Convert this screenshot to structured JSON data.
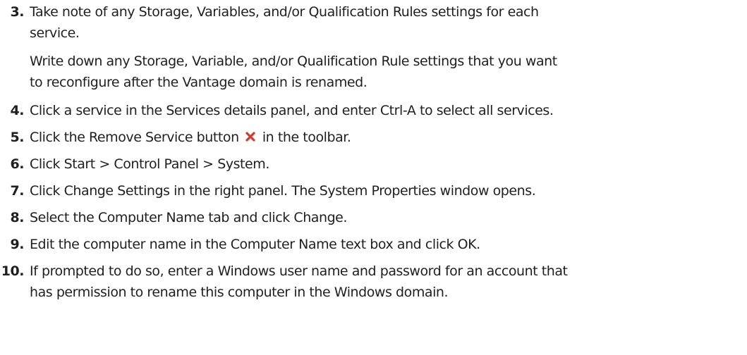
{
  "steps": [
    {
      "number": "3.",
      "lines": [
        "Take note of any Storage, Variables, and/or Qualification Rules settings for each",
        "service."
      ]
    },
    {
      "note_lines": [
        "Write down any Storage, Variable, and/or Qualification Rule settings that you want",
        "to reconfigure after the Vantage domain is renamed."
      ]
    },
    {
      "number": "4.",
      "text": "Click a service in the Services details panel, and enter Ctrl-A to select all services."
    },
    {
      "number": "5.",
      "before_icon": "Click the Remove Service button",
      "after_icon": "in the toolbar.",
      "icon": "remove-service-icon",
      "icon_color": "#d33a2c"
    },
    {
      "number": "6.",
      "text": "Click Start > Control Panel > System."
    },
    {
      "number": "7.",
      "text": "Click Change Settings in the right panel. The System Properties window opens."
    },
    {
      "number": "8.",
      "text": "Select the Computer Name tab and click Change."
    },
    {
      "number": "9.",
      "text": "Edit the computer name in the Computer Name text box and click OK."
    },
    {
      "number": "10.",
      "lines": [
        "If prompted to do so, enter a Windows user name and password for an account that",
        "has permission to rename this computer in the Windows domain."
      ]
    }
  ]
}
